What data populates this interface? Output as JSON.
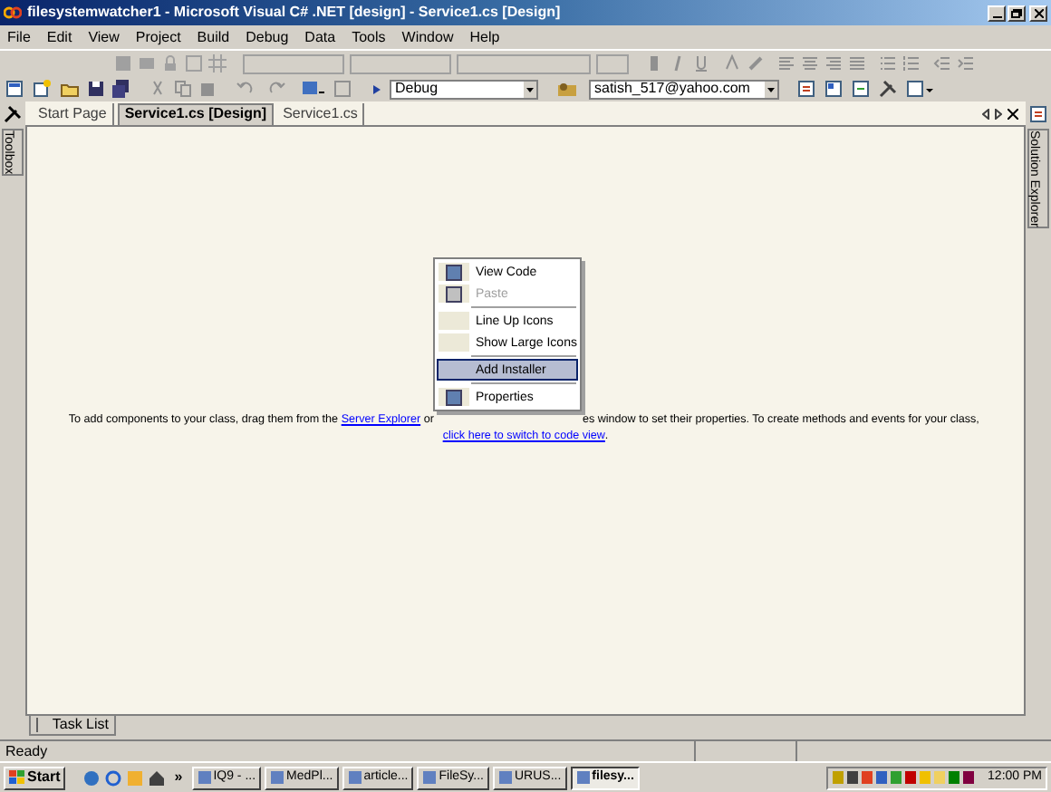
{
  "window": {
    "title": "filesystemwatcher1 - Microsoft Visual C# .NET [design] - Service1.cs [Design]"
  },
  "menu": [
    "File",
    "Edit",
    "View",
    "Project",
    "Build",
    "Debug",
    "Data",
    "Tools",
    "Window",
    "Help"
  ],
  "toolbar": {
    "configuration": "Debug",
    "find": "satish_517@yahoo.com"
  },
  "side_tabs": {
    "left": "Toolbox",
    "right": "Solution Explorer"
  },
  "tabs": [
    {
      "label": "Start Page",
      "selected": false
    },
    {
      "label": "Service1.cs [Design]",
      "selected": true
    },
    {
      "label": "Service1.cs",
      "selected": false
    }
  ],
  "designer_message": {
    "before": "To add components to your class, drag them from the ",
    "link_1": "Server Explorer",
    "middle_1": " or",
    "middle_2": "es window to set their properties. To create methods and events for your class, ",
    "link_2": "click here to switch to code view",
    "after": "."
  },
  "context_menu": [
    {
      "kind": "item",
      "label": "View Code",
      "icon": true,
      "disabled": false,
      "selected": false
    },
    {
      "kind": "item",
      "label": "Paste",
      "icon": true,
      "disabled": true,
      "selected": false
    },
    {
      "kind": "separator"
    },
    {
      "kind": "item",
      "label": "Line Up Icons",
      "icon": false,
      "disabled": false,
      "selected": false
    },
    {
      "kind": "item",
      "label": "Show Large Icons",
      "icon": false,
      "disabled": false,
      "selected": false
    },
    {
      "kind": "separator"
    },
    {
      "kind": "item",
      "label": "Add Installer",
      "icon": false,
      "disabled": false,
      "selected": true
    },
    {
      "kind": "separator"
    },
    {
      "kind": "item",
      "label": "Properties",
      "icon": true,
      "disabled": false,
      "selected": false
    }
  ],
  "bottom_tabs": [
    {
      "label": "Task List"
    }
  ],
  "status_bar": {
    "text": "Ready"
  },
  "taskbar": {
    "start": "Start",
    "chevron": "»",
    "buttons": [
      {
        "label": "IQ9 - ...",
        "selected": false
      },
      {
        "label": "MedPl...",
        "selected": false
      },
      {
        "label": "article...",
        "selected": false
      },
      {
        "label": "FileSy...",
        "selected": false
      },
      {
        "label": "URUS...",
        "selected": false
      },
      {
        "label": "filesy...",
        "selected": true
      }
    ],
    "clock": "12:00 PM"
  }
}
